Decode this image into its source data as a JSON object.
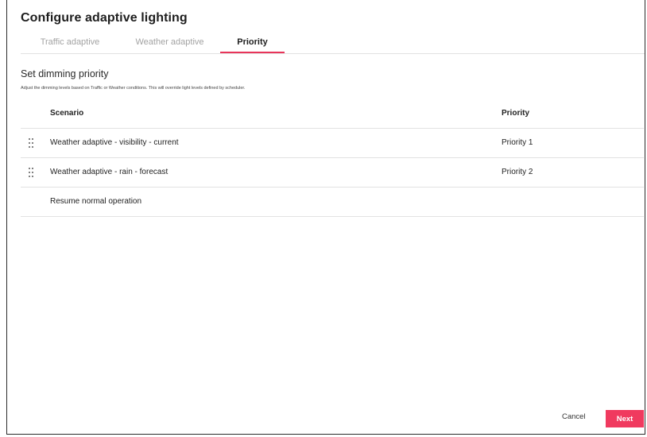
{
  "dialog": {
    "title": "Configure adaptive lighting",
    "tabs": [
      {
        "label": "Traffic adaptive"
      },
      {
        "label": "Weather adaptive"
      },
      {
        "label": "Priority"
      }
    ],
    "active_tab": "Priority",
    "accent_color": "#e8355a"
  },
  "section": {
    "title": "Set dimming priority",
    "description": "Adjust the dimming levels based on Traffic or Weather conditions. This will override light levels defined by scheduler."
  },
  "table": {
    "headers": {
      "scenario": "Scenario",
      "priority": "Priority"
    },
    "rows": [
      {
        "scenario": "Weather adaptive - visibility - current",
        "priority": "Priority 1",
        "icon": "drag-handle-icon"
      },
      {
        "scenario": "Weather adaptive - rain - forecast",
        "priority": "Priority 2",
        "icon": "drag-handle-icon"
      },
      {
        "scenario": "Resume normal operation",
        "priority": ""
      }
    ]
  },
  "footer": {
    "cancel_label": "Cancel",
    "next_label": "Next",
    "next_color": "#f03a5f"
  }
}
